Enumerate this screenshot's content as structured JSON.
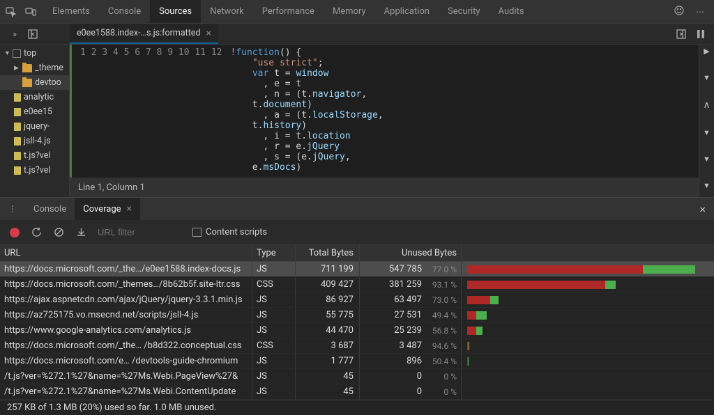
{
  "topTabs": [
    "Elements",
    "Console",
    "Sources",
    "Network",
    "Performance",
    "Memory",
    "Application",
    "Security",
    "Audits"
  ],
  "activeTopTab": "Sources",
  "fileTab": {
    "label": "e0ee1588.index-…s.js:formatted"
  },
  "fileTree": {
    "top": "top",
    "themes": "_theme",
    "devtools": "devtoo",
    "files": [
      "analytic",
      "e0ee15",
      "jquery-",
      "jsll-4.js",
      "t.js?vel",
      "t.js?vel"
    ]
  },
  "code": {
    "lineCount": 12,
    "lines": [
      "!function() {",
      "    \"use strict\";",
      "    var t = window",
      "      , e = t",
      "      , n = (t.navigator,",
      "    t.document)",
      "      , a = (t.localStorage,",
      "    t.history)",
      "      , i = t.location",
      "      , r = e.jQuery",
      "      , s = (e.jQuery,",
      "    e.msDocs)"
    ]
  },
  "statusBar": "Line 1, Column 1",
  "drawer": {
    "tabs": [
      "Console",
      "Coverage"
    ],
    "activeTab": "Coverage"
  },
  "coverageToolbar": {
    "filterPlaceholder": "URL filter",
    "contentScriptsLabel": "Content scripts"
  },
  "coverageHeaders": {
    "url": "URL",
    "type": "Type",
    "total": "Total Bytes",
    "unused": "Unused Bytes"
  },
  "coverageRows": [
    {
      "url": "https://docs.microsoft.com/_the…/e0ee1588.index-docs.js",
      "type": "JS",
      "total": "711 199",
      "unused": "547 785",
      "pct": "77.0 %",
      "barPct": 95,
      "usedPct": 23,
      "selected": true
    },
    {
      "url": "https://docs.microsoft.com/_themes…/8b62b5f.site-ltr.css",
      "type": "CSS",
      "total": "409 427",
      "unused": "381 259",
      "pct": "93.1 %",
      "barPct": 62,
      "usedPct": 7
    },
    {
      "url": "https://ajax.aspnetcdn.com/ajax/jQuery/jquery-3.3.1.min.js",
      "type": "JS",
      "total": "86 927",
      "unused": "63 497",
      "pct": "73.0 %",
      "barPct": 13,
      "usedPct": 27
    },
    {
      "url": "https://az725175.vo.msecnd.net/scripts/jsll-4.js",
      "type": "JS",
      "total": "55 775",
      "unused": "27 531",
      "pct": "49.4 %",
      "barPct": 8,
      "usedPct": 51
    },
    {
      "url": "https://www.google-analytics.com/analytics.js",
      "type": "JS",
      "total": "44 470",
      "unused": "25 239",
      "pct": "56.8 %",
      "barPct": 6.5,
      "usedPct": 43
    },
    {
      "url": "https://docs.microsoft.com/_the… /b8d322.conceptual.css",
      "type": "CSS",
      "total": "3 687",
      "unused": "3 487",
      "pct": "94.6 %",
      "barPct": 0.6,
      "usedPct": 5
    },
    {
      "url": "https://docs.microsoft.com/e… /devtools-guide-chromium",
      "type": "JS",
      "total": "1 777",
      "unused": "896",
      "pct": "50.4 %",
      "barPct": 0.3,
      "usedPct": 50
    },
    {
      "url": "/t.js?ver=%272.1%27&name=%27Ms.Webi.PageView%27&",
      "type": "JS",
      "total": "45",
      "unused": "0",
      "pct": "0 %",
      "barPct": 0,
      "usedPct": 0
    },
    {
      "url": "/t.js?ver=%272.1%27&name=%27Ms.Webi.ContentUpdate",
      "type": "JS",
      "total": "45",
      "unused": "0",
      "pct": "0 %",
      "barPct": 0,
      "usedPct": 0
    }
  ],
  "coverageFooter": "257 KB of 1.3 MB (20%) used so far. 1.0 MB unused."
}
